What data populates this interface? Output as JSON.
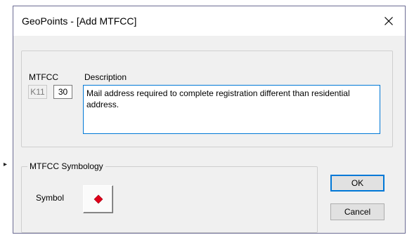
{
  "window": {
    "title": "GeoPoints - [Add MTFCC]"
  },
  "mtfcc": {
    "column_label": "MTFCC",
    "prefix": "K11",
    "code": "30",
    "description_label": "Description",
    "description": "Mail address required to complete registration different than residential address."
  },
  "symbology": {
    "group_label": "MTFCC Symbology",
    "symbol_label": "Symbol",
    "symbol_icon": "red-diamond-icon",
    "symbol_color": "#e0001b"
  },
  "buttons": {
    "ok": "OK",
    "cancel": "Cancel"
  }
}
